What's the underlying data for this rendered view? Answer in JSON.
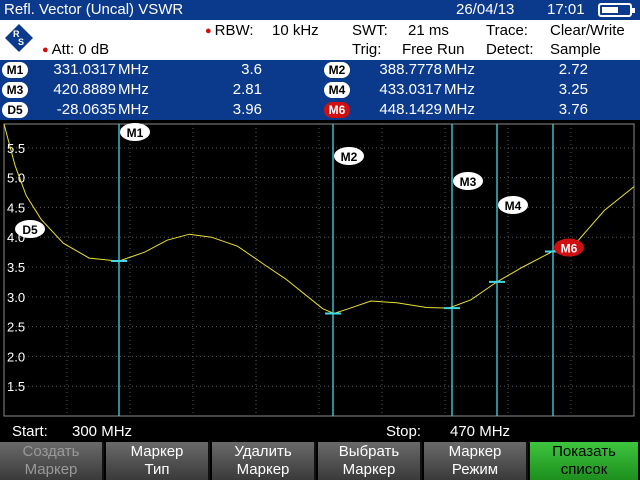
{
  "title": "Refl. Vector (Uncal) VSWR",
  "date": "26/04/13",
  "time": "17:01",
  "battery_level": 0.6,
  "info": {
    "att": "Att:  0 dB",
    "rbw_label": "RBW:",
    "rbw_value": "10 kHz",
    "swt_label": "SWT:",
    "swt_value": "21 ms",
    "trig_label": "Trig:",
    "trig_value": "Free Run",
    "trace_label": "Trace:",
    "trace_value": "Clear/Write",
    "detect_label": "Detect:",
    "detect_value": "Sample"
  },
  "markers": [
    {
      "label": "M1",
      "freq": "331.0317",
      "unit": "MHz",
      "value": "3.6",
      "active": false
    },
    {
      "label": "M2",
      "freq": "388.7778",
      "unit": "MHz",
      "value": "2.72",
      "active": false
    },
    {
      "label": "M3",
      "freq": "420.8889",
      "unit": "MHz",
      "value": "2.81",
      "active": false
    },
    {
      "label": "M4",
      "freq": "433.0317",
      "unit": "MHz",
      "value": "3.25",
      "active": false
    },
    {
      "label": "D5",
      "freq": "-28.0635",
      "unit": "MHz",
      "value": "3.96",
      "active": false
    },
    {
      "label": "M6",
      "freq": "448.1429",
      "unit": "MHz",
      "value": "3.76",
      "active": true
    }
  ],
  "footer": {
    "start_label": "Start:",
    "start_value": "300 MHz",
    "stop_label": "Stop:",
    "stop_value": "470 MHz"
  },
  "softkeys": [
    {
      "line1": "Создать",
      "line2": "Маркер",
      "disabled": true
    },
    {
      "line1": "Маркер",
      "line2": "Тип",
      "disabled": false
    },
    {
      "line1": "Удалить",
      "line2": "Маркер",
      "disabled": false
    },
    {
      "line1": "Выбрать",
      "line2": "Маркер",
      "disabled": false
    },
    {
      "line1": "Маркер",
      "line2": "Режим",
      "disabled": false
    },
    {
      "line1": "Показать",
      "line2": "список",
      "disabled": false,
      "highlight": true
    }
  ],
  "chart_data": {
    "type": "line",
    "x_start": 300,
    "x_end": 470,
    "ylim": [
      1.0,
      5.9
    ],
    "yticks": [
      "5.5",
      "5.0",
      "4.5",
      "4.0",
      "3.5",
      "3.0",
      "2.5",
      "2.0",
      "1.5"
    ],
    "grid": true,
    "trace_color": "#e8e030",
    "marker_line_color": "#40d8e8",
    "x": [
      300,
      303,
      306,
      310,
      316,
      323,
      331,
      338,
      344,
      350,
      356,
      363,
      370,
      376,
      382,
      386,
      389,
      393,
      399,
      406,
      414,
      420,
      426,
      433,
      440,
      448,
      455,
      462,
      470
    ],
    "y": [
      5.9,
      5.2,
      4.7,
      4.3,
      3.9,
      3.65,
      3.6,
      3.75,
      3.95,
      4.05,
      4.0,
      3.85,
      3.55,
      3.3,
      3.0,
      2.8,
      2.72,
      2.8,
      2.93,
      2.9,
      2.82,
      2.81,
      2.95,
      3.25,
      3.5,
      3.76,
      3.95,
      4.45,
      4.85
    ],
    "marker_points": [
      {
        "label": "M1",
        "x": 331.0317,
        "y": 3.6
      },
      {
        "label": "M2",
        "x": 388.7778,
        "y": 2.72
      },
      {
        "label": "M3",
        "x": 420.8889,
        "y": 2.81
      },
      {
        "label": "M4",
        "x": 433.0317,
        "y": 3.25
      },
      {
        "label": "D5",
        "x": 303.0,
        "y": 3.96
      },
      {
        "label": "M6",
        "x": 448.1429,
        "y": 3.76
      }
    ]
  }
}
